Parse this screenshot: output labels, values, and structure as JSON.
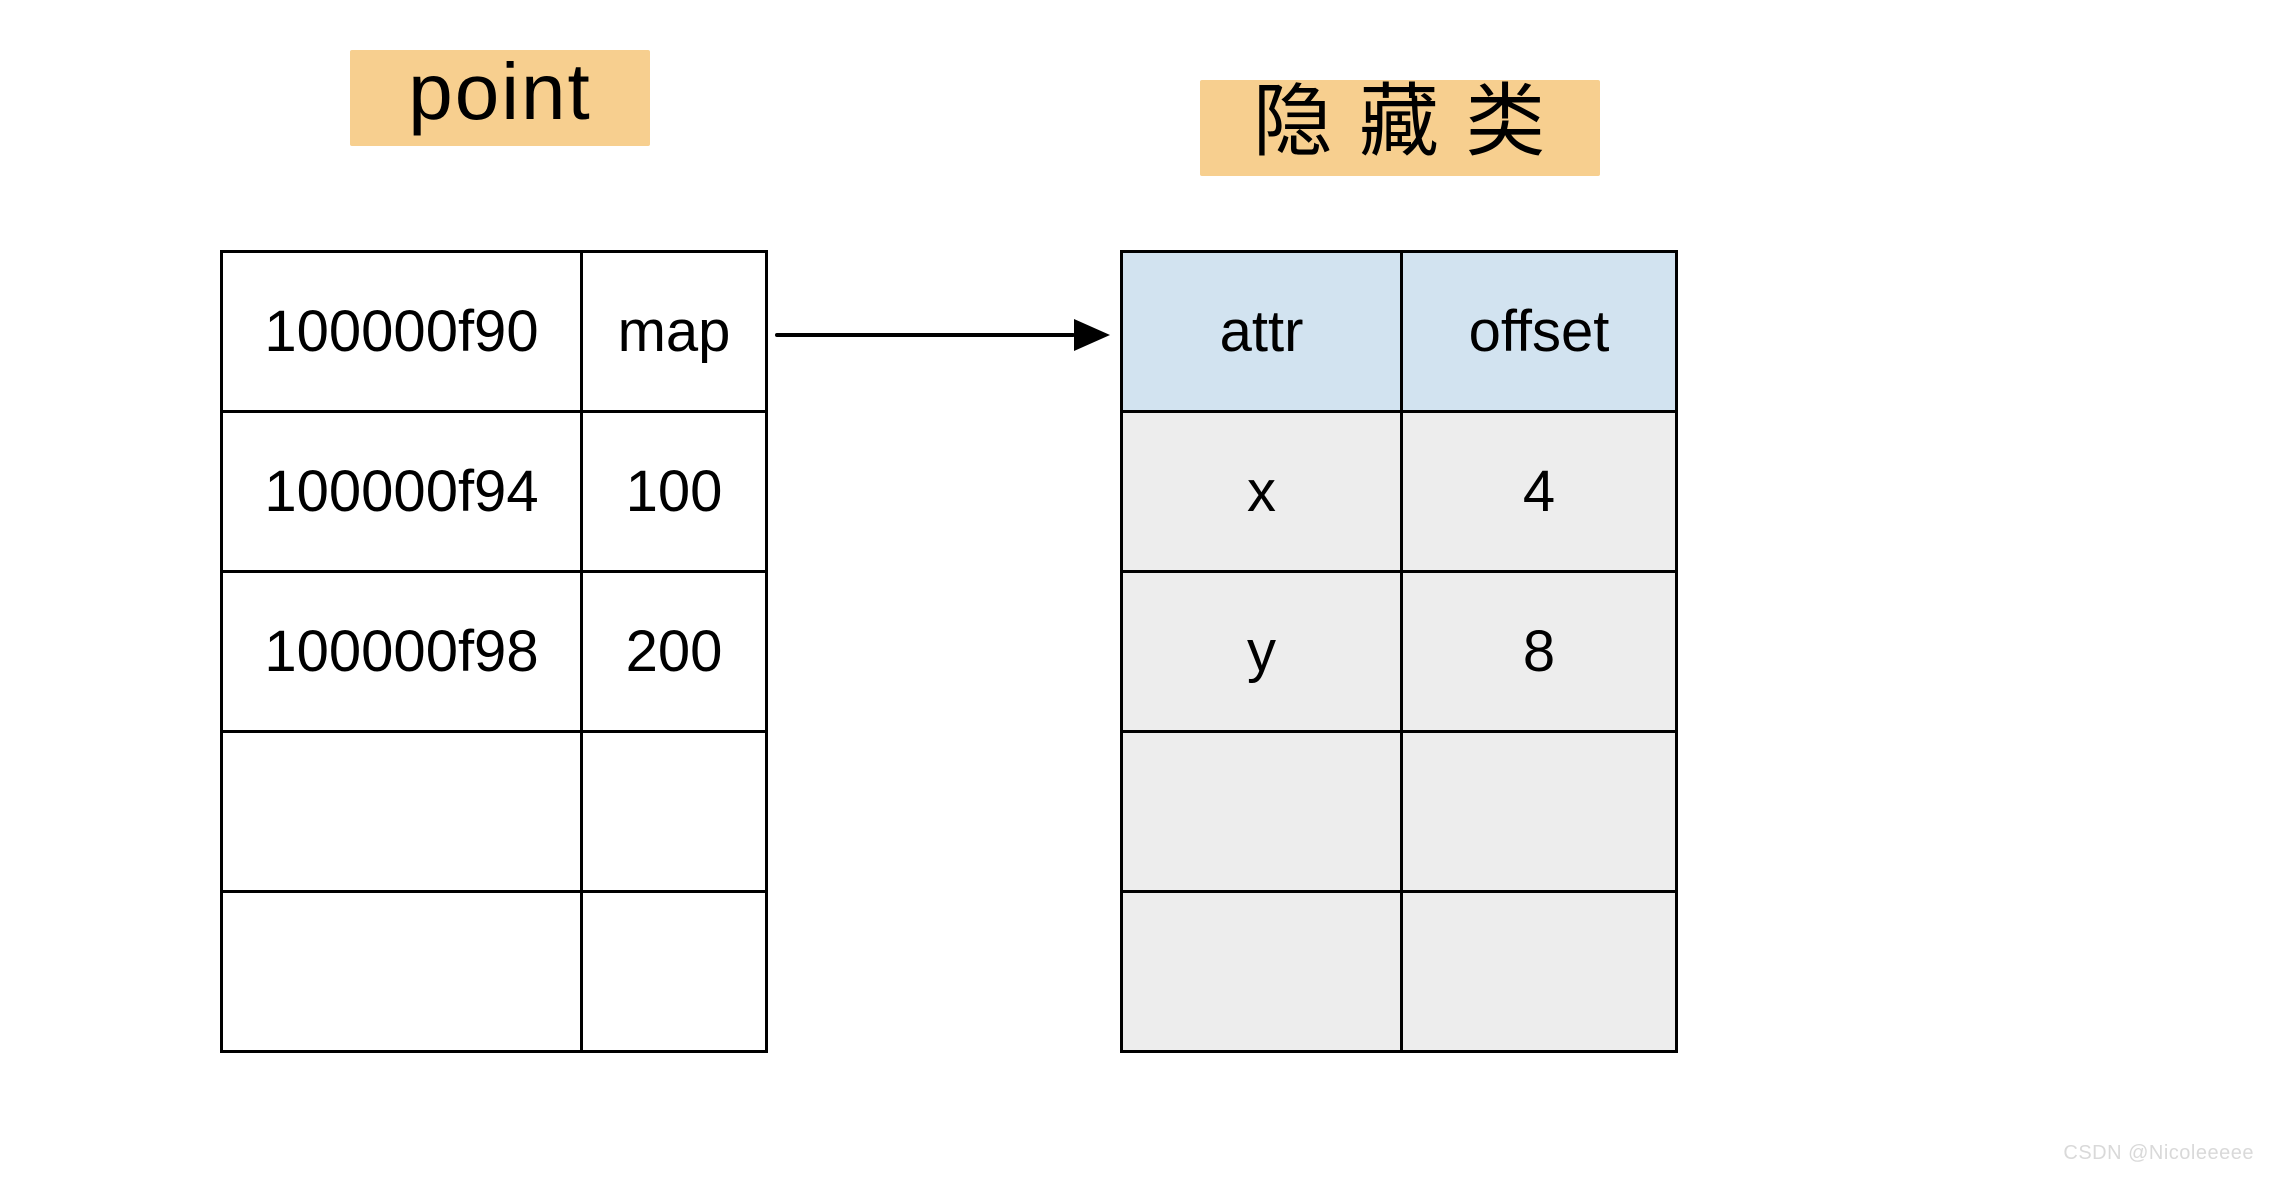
{
  "titles": {
    "left": "point",
    "right": "隐 藏 类"
  },
  "point_table": {
    "rows": [
      {
        "address": "100000f90",
        "value": "map"
      },
      {
        "address": "100000f94",
        "value": "100"
      },
      {
        "address": "100000f98",
        "value": "200"
      },
      {
        "address": "",
        "value": ""
      },
      {
        "address": "",
        "value": ""
      }
    ]
  },
  "hidden_class_table": {
    "headers": {
      "attr": "attr",
      "offset": "offset"
    },
    "rows": [
      {
        "attr": "x",
        "offset": "4"
      },
      {
        "attr": "y",
        "offset": "8"
      },
      {
        "attr": "",
        "offset": ""
      },
      {
        "attr": "",
        "offset": ""
      }
    ]
  },
  "arrow": {
    "from": "point_table.rows.0.value",
    "to": "hidden_class_table.headers"
  },
  "watermark": "CSDN @Nicoleeeee",
  "colors": {
    "highlight": "#f7cf8f",
    "hidden_header_bg": "#d2e3f0",
    "hidden_body_bg": "#ededed",
    "point_body_bg": "#ffffff",
    "border": "#000000"
  }
}
